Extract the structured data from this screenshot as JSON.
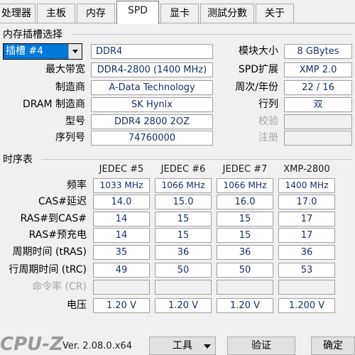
{
  "tabs": [
    {
      "label": "处理器"
    },
    {
      "label": "主板"
    },
    {
      "label": "内存"
    },
    {
      "label": "SPD"
    },
    {
      "label": "显卡"
    },
    {
      "label": "测試分數"
    },
    {
      "label": "关于"
    }
  ],
  "slot_group": {
    "title": "内存插槽选择",
    "slot_value": "插槽 #4",
    "type_value": "DDR4",
    "rows": [
      {
        "label": "最大带宽",
        "value": "DDR4-2800 (1400 MHz)"
      },
      {
        "label": "制造商",
        "value": "A-Data Technology"
      },
      {
        "label": "DRAM 制造商",
        "value": "SK Hynix"
      },
      {
        "label": "型号",
        "value": "DDR4 2800 2OZ"
      },
      {
        "label": "序列号",
        "value": "74760000"
      }
    ],
    "right": [
      {
        "label": "模块大小",
        "value": "8 GBytes"
      },
      {
        "label": "SPD扩展",
        "value": "XMP 2.0"
      },
      {
        "label": "周次/年份",
        "value": "22 / 16"
      },
      {
        "label": "行列",
        "value": "双"
      },
      {
        "label": "校验",
        "value": ""
      },
      {
        "label": "注册",
        "value": ""
      }
    ]
  },
  "timing": {
    "title": "时序表",
    "columns": [
      "JEDEC #5",
      "JEDEC #6",
      "JEDEC #7",
      "XMP-2800"
    ],
    "rows": [
      {
        "label": "频率",
        "values": [
          "1033 MHz",
          "1066 MHz",
          "1066 MHz",
          "1400 MHz"
        ]
      },
      {
        "label": "CAS#延迟",
        "values": [
          "14.0",
          "15.0",
          "16.0",
          "17.0"
        ]
      },
      {
        "label": "RAS#到CAS#",
        "values": [
          "14",
          "15",
          "15",
          "17"
        ]
      },
      {
        "label": "RAS#预充电",
        "values": [
          "14",
          "15",
          "15",
          "17"
        ]
      },
      {
        "label": "周期时间 (tRAS)",
        "values": [
          "35",
          "36",
          "36",
          "36"
        ]
      },
      {
        "label": "行周期时间 (tRC)",
        "values": [
          "49",
          "50",
          "50",
          "53"
        ]
      },
      {
        "label": "命令率 (CR)",
        "values": [
          "",
          "",
          "",
          ""
        ]
      },
      {
        "label": "电压",
        "values": [
          "1.20 V",
          "1.20 V",
          "1.20 V",
          "1.200 V"
        ]
      }
    ]
  },
  "footer": {
    "logo": "CPU-Z",
    "version": "Ver. 2.08.0.x64",
    "tools": "工具",
    "validate": "验证",
    "ok": "确定"
  }
}
